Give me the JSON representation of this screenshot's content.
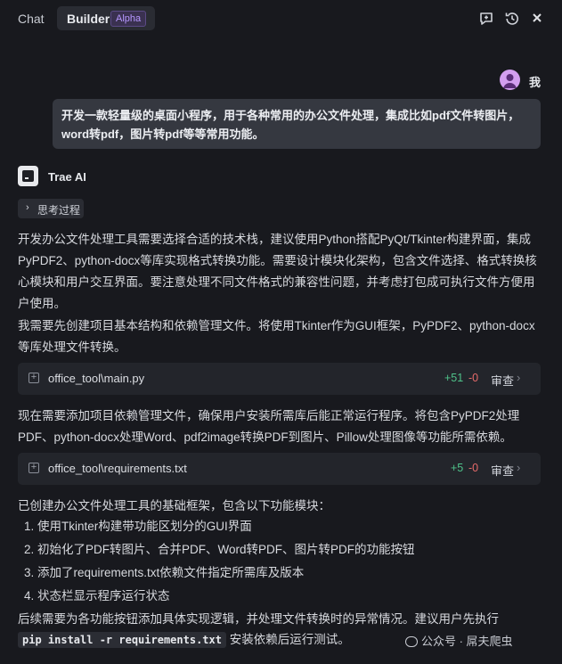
{
  "topbar": {
    "tab_chat": "Chat",
    "tab_builder": "Builder",
    "builder_badge": "Alpha",
    "icons": [
      "new-chat-icon",
      "history-icon",
      "close-icon"
    ]
  },
  "user": {
    "name": "我",
    "message": "开发一款轻量级的桌面小程序，用于各种常用的办公文件处理，集成比如pdf文件转图片，word转pdf，图片转pdf等等常用功能。"
  },
  "assistant": {
    "name": "Trae AI",
    "thinking_label": "思考过程",
    "para1": "开发办公文件处理工具需要选择合适的技术栈，建议使用Python搭配PyQt/Tkinter构建界面，集成PyPDF2、python-docx等库实现格式转换功能。需要设计模块化架构，包含文件选择、格式转换核心模块和用户交互界面。要注意处理不同文件格式的兼容性问题，并考虑打包成可执行文件方便用户使用。",
    "para2": "我需要先创建项目基本结构和依赖管理文件。将使用Tkinter作为GUI框架，PyPDF2、python-docx等库处理文件转换。",
    "file1": {
      "name": "office_tool\\main.py",
      "added": "+51",
      "removed": "-0",
      "review": "审查"
    },
    "para3": "现在需要添加项目依赖管理文件，确保用户安装所需库后能正常运行程序。将包含PyPDF2处理PDF、python-docx处理Word、pdf2image转换PDF到图片、Pillow处理图像等功能所需依赖。",
    "file2": {
      "name": "office_tool\\requirements.txt",
      "added": "+5",
      "removed": "-0",
      "review": "审查"
    },
    "summary_intro": "已创建办公文件处理工具的基础框架，包含以下功能模块：",
    "summary_items": [
      "1. 使用Tkinter构建带功能区划分的GUI界面",
      "2. 初始化了PDF转图片、合并PDF、Word转PDF、图片转PDF的功能按钮",
      "3. 添加了requirements.txt依赖文件指定所需库及版本",
      "4. 状态栏显示程序运行状态"
    ],
    "followup_line1": "后续需要为各功能按钮添加具体实现逻辑，并处理文件转换时的异常情况。建议用户先执行",
    "followup_code": "pip install -r requirements.txt",
    "followup_tail": "安装依赖后运行测试。"
  },
  "watermark": "公众号 · 屌夫爬虫",
  "colors": {
    "background": "#18191e",
    "user_bubble": "#353840",
    "added": "#4fc28a",
    "removed": "#e66a6a",
    "alpha_badge": "#b697ff"
  }
}
